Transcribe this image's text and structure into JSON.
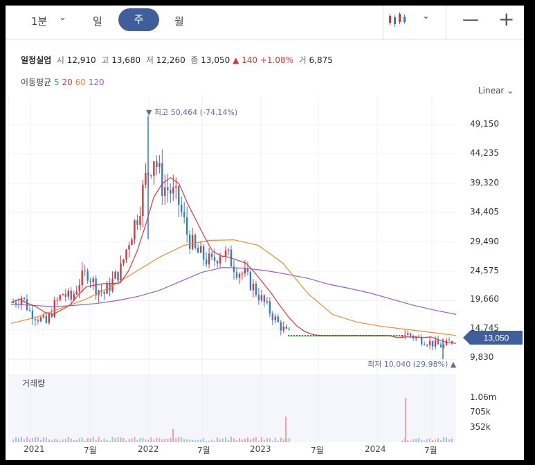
{
  "toolbar": {
    "interval_label": "1분",
    "tabs": [
      "일",
      "주",
      "월"
    ],
    "active_tab": "주"
  },
  "stock": {
    "name": "일정실업",
    "open_label": "시",
    "open": "12,910",
    "high_label": "고",
    "high": "13,680",
    "low_label": "저",
    "low": "12,260",
    "close_label": "종",
    "close": "13,050",
    "change": "▲ 140",
    "change_pct": "+1.08%",
    "volume_label": "거",
    "volume": "6,875"
  },
  "moving_avg": {
    "label": "이동평균",
    "periods": [
      {
        "value": "5",
        "color": "#3aa845"
      },
      {
        "value": "20",
        "color": "#e0323c"
      },
      {
        "value": "60",
        "color": "#f08a24"
      },
      {
        "value": "120",
        "color": "#9b59d0"
      }
    ]
  },
  "scale_label": "Linear",
  "price_axis": [
    "49,150",
    "44,235",
    "39,320",
    "34,405",
    "29,490",
    "24,575",
    "19,660",
    "14,745",
    "9,830"
  ],
  "current_price": "13,050",
  "high_marker": "▼ 최고 50,464 (-74.14%)",
  "low_marker": "최저 10,040 (29.98%) ▲",
  "volume_panel": {
    "label": "거래량",
    "axis": [
      "1.06m",
      "705k",
      "352k"
    ]
  },
  "time_axis": [
    "2021",
    "7월",
    "2022",
    "7월",
    "2023",
    "7월",
    "2024",
    "7월"
  ],
  "colors": {
    "up": "#e0323c",
    "down": "#2f7fcf",
    "accent": "#3f5f9c"
  },
  "chart_data": {
    "type": "candlestick",
    "interval": "weekly",
    "y_range": [
      9830,
      50464
    ],
    "high": 50464,
    "low": 10040,
    "last_close": 13050,
    "close_series": [
      19500,
      20500,
      18000,
      17000,
      16000,
      19000,
      21000,
      20000,
      23000,
      24500,
      22000,
      21000,
      23000,
      25000,
      30000,
      34000,
      40000,
      44000,
      39000,
      38000,
      36000,
      31000,
      28000,
      27000,
      26000,
      28000,
      27000,
      25000,
      24000,
      22000,
      20000,
      18000,
      16000,
      14500,
      14000,
      14000,
      14000,
      14000,
      14000,
      14000,
      14000,
      14000,
      14000,
      14000,
      14000,
      14000,
      12500,
      14500,
      14000,
      13500,
      13000,
      12500,
      12200,
      13050
    ],
    "ma120": [
      19200,
      19000,
      18800,
      19000,
      19300,
      19800,
      20500,
      21500,
      23000,
      24500,
      25300,
      25200,
      24800,
      24200,
      23500,
      22500,
      21800,
      21000,
      20000,
      19000,
      18200,
      17500
    ],
    "ma60": [
      16000,
      17000,
      18500,
      20000,
      22000,
      24500,
      27000,
      29000,
      29800,
      29900,
      29000,
      26000,
      21000,
      17500,
      16200,
      15500,
      15000,
      14500,
      14000
    ],
    "volume_axis": [
      1060000,
      705000,
      352000
    ]
  }
}
